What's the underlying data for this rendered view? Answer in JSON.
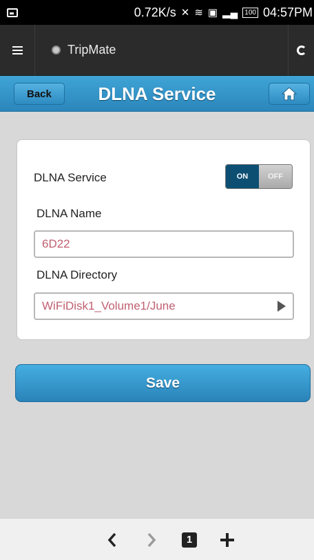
{
  "status_bar": {
    "speed": "0.72K/s",
    "battery": "100",
    "time": "04:57PM"
  },
  "browser": {
    "site_title": "TripMate"
  },
  "header": {
    "back_label": "Back",
    "title": "DLNA Service"
  },
  "settings": {
    "service_label": "DLNA Service",
    "toggle_on": "ON",
    "toggle_off": "OFF",
    "name_label": "DLNA Name",
    "name_value": "6D22",
    "directory_label": "DLNA Directory",
    "directory_value": "WiFiDisk1_Volume1/June"
  },
  "actions": {
    "save_label": "Save"
  },
  "bottom_nav": {
    "tab_count": "1"
  },
  "colors": {
    "header_blue": "#2b86bb",
    "value_text": "#c06070",
    "toggle_on": "#0d4f73"
  }
}
